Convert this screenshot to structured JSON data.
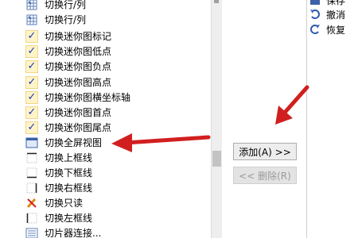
{
  "left_list": {
    "items": [
      {
        "label": "切换行/列",
        "icon": "grid-icon",
        "checked": false
      },
      {
        "label": "切换行/列",
        "icon": "grid-icon",
        "checked": false
      },
      {
        "label": "切换迷你图标记",
        "icon": "check-icon",
        "checked": true
      },
      {
        "label": "切换迷你图低点",
        "icon": "check-icon",
        "checked": true
      },
      {
        "label": "切换迷你图负点",
        "icon": "check-icon",
        "checked": true
      },
      {
        "label": "切换迷你图高点",
        "icon": "check-icon",
        "checked": true
      },
      {
        "label": "切换迷你图横坐标轴",
        "icon": "check-icon",
        "checked": true
      },
      {
        "label": "切换迷你图首点",
        "icon": "check-icon",
        "checked": true
      },
      {
        "label": "切换迷你图尾点",
        "icon": "check-icon",
        "checked": true
      },
      {
        "label": "切换全屏视图",
        "icon": "fullscreen-icon",
        "checked": false
      },
      {
        "label": "切换上框线",
        "icon": "border-top-icon",
        "checked": false
      },
      {
        "label": "切换下框线",
        "icon": "border-bottom-icon",
        "checked": false
      },
      {
        "label": "切换右框线",
        "icon": "border-right-icon",
        "checked": false
      },
      {
        "label": "切换只读",
        "icon": "read-only-icon",
        "checked": false
      },
      {
        "label": "切换左框线",
        "icon": "border-left-icon",
        "checked": false
      },
      {
        "label": "切片器连接...",
        "icon": "slicer-icon",
        "checked": false
      }
    ]
  },
  "buttons": {
    "add_label": "添加(A) >>",
    "remove_label": "<< 删除(R)"
  },
  "right_list": {
    "items": [
      {
        "label": "保存",
        "icon": "save-icon"
      },
      {
        "label": "撤消",
        "icon": "undo-icon"
      },
      {
        "label": "恢复",
        "icon": "redo-icon"
      }
    ]
  },
  "colors": {
    "arrow": "#d11f1f",
    "check": "#1c3bb0",
    "check_bg": "#fff3c9"
  }
}
